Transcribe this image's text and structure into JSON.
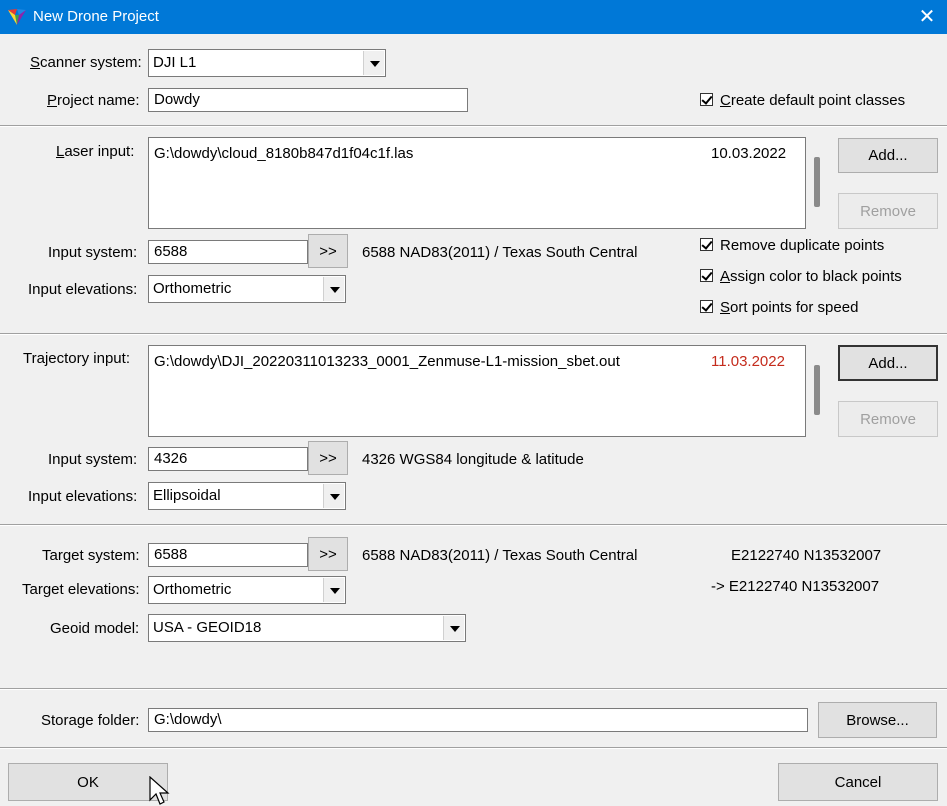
{
  "window": {
    "title": "New Drone Project",
    "close_glyph": "✕"
  },
  "header": {
    "scanner_label": "Scanner system:",
    "scanner_value": "DJI L1",
    "project_label": "Project name:",
    "project_value": "Dowdy",
    "default_classes_label": "Create default point classes",
    "default_classes_checked": true
  },
  "laser": {
    "label": "Laser input:",
    "files": [
      {
        "path": "G:\\dowdy\\cloud_8180b847d1f04c1f.las",
        "date": "10.03.2022"
      }
    ],
    "add_label": "Add...",
    "remove_label": "Remove",
    "input_system_label": "Input system:",
    "input_system_value": "6588",
    "pick_label": ">>",
    "input_system_desc": "6588 NAD83(2011) / Texas South Central",
    "elevations_label": "Input elevations:",
    "elevations_value": "Orthometric",
    "remove_duplicates_label": "Remove duplicate points",
    "assign_color_label": "Assign color to black points",
    "sort_points_label": "Sort points for speed"
  },
  "trajectory": {
    "label": "Trajectory input:",
    "files": [
      {
        "path": "G:\\dowdy\\DJI_20220311013233_0001_Zenmuse-L1-mission_sbet.out",
        "date": "11.03.2022"
      }
    ],
    "add_label": "Add...",
    "remove_label": "Remove",
    "input_system_label": "Input system:",
    "input_system_value": "4326",
    "pick_label": ">>",
    "input_system_desc": "4326 WGS84 longitude & latitude",
    "elevations_label": "Input elevations:",
    "elevations_value": "Ellipsoidal"
  },
  "target": {
    "system_label": "Target system:",
    "system_value": "6588",
    "pick_label": ">>",
    "system_desc": "6588 NAD83(2011) / Texas South Central",
    "coord_line1": "E2122740 N13532007",
    "coord_line2": "-> E2122740 N13532007",
    "elevations_label": "Target elevations:",
    "elevations_value": "Orthometric",
    "geoid_label": "Geoid model:",
    "geoid_value": "USA - GEOID18"
  },
  "storage": {
    "label": "Storage folder:",
    "value": "G:\\dowdy\\",
    "browse_label": "Browse..."
  },
  "footer": {
    "ok_label": "OK",
    "cancel_label": "Cancel"
  },
  "colors": {
    "titlebar": "#0078d7",
    "highlight_date": "#c42b1c"
  }
}
